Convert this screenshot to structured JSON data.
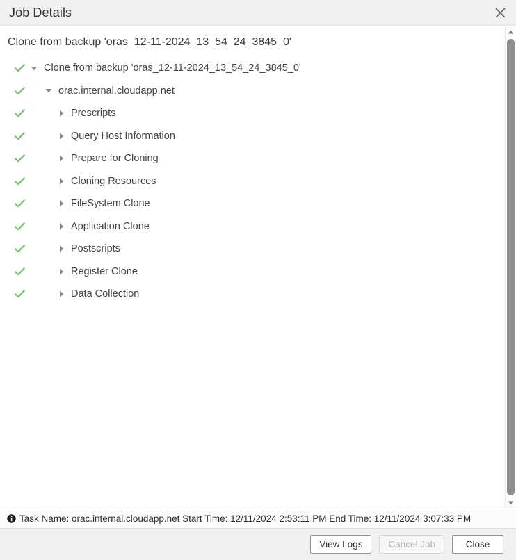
{
  "titlebar": {
    "title": "Job Details",
    "close_icon": "close-icon"
  },
  "content": {
    "job_heading": "Clone from backup 'oras_12-11-2024_13_54_24_3845_0'",
    "tree": [
      {
        "label": "Clone from backup 'oras_12-11-2024_13_54_24_3845_0'",
        "level": 0,
        "status": "success",
        "twisty": "expanded"
      },
      {
        "label": "orac.internal.cloudapp.net",
        "level": 1,
        "status": "success",
        "twisty": "expanded"
      },
      {
        "label": "Prescripts",
        "level": 2,
        "status": "success",
        "twisty": "collapsed"
      },
      {
        "label": "Query Host Information",
        "level": 2,
        "status": "success",
        "twisty": "collapsed"
      },
      {
        "label": "Prepare for Cloning",
        "level": 2,
        "status": "success",
        "twisty": "collapsed"
      },
      {
        "label": "Cloning Resources",
        "level": 2,
        "status": "success",
        "twisty": "collapsed"
      },
      {
        "label": "FileSystem Clone",
        "level": 2,
        "status": "success",
        "twisty": "collapsed"
      },
      {
        "label": "Application Clone",
        "level": 2,
        "status": "success",
        "twisty": "collapsed"
      },
      {
        "label": "Postscripts",
        "level": 2,
        "status": "success",
        "twisty": "collapsed"
      },
      {
        "label": "Register Clone",
        "level": 2,
        "status": "success",
        "twisty": "collapsed"
      },
      {
        "label": "Data Collection",
        "level": 2,
        "status": "success",
        "twisty": "collapsed"
      }
    ]
  },
  "scrollbar": {
    "up_icon": "scroll-up-arrow-icon",
    "down_icon": "scroll-down-arrow-icon"
  },
  "statusbar": {
    "info_icon": "info-icon",
    "text": "Task Name: orac.internal.cloudapp.net Start Time: 12/11/2024 2:53:11 PM End Time: 12/11/2024 3:07:33 PM",
    "task_name": "orac.internal.cloudapp.net",
    "start_time": "12/11/2024 2:53:11 PM",
    "end_time": "12/11/2024 3:07:33 PM"
  },
  "footer": {
    "view_logs_label": "View Logs",
    "cancel_job_label": "Cancel Job",
    "close_label": "Close",
    "cancel_job_disabled": true
  },
  "colors": {
    "success_check": "#72c472",
    "twisty": "#8a8a8a",
    "titlebar_bg": "#f0f0f0",
    "footer_bg": "#f0f0f0",
    "text": "#3f4448",
    "scroll_thumb": "#8e8e8e"
  }
}
